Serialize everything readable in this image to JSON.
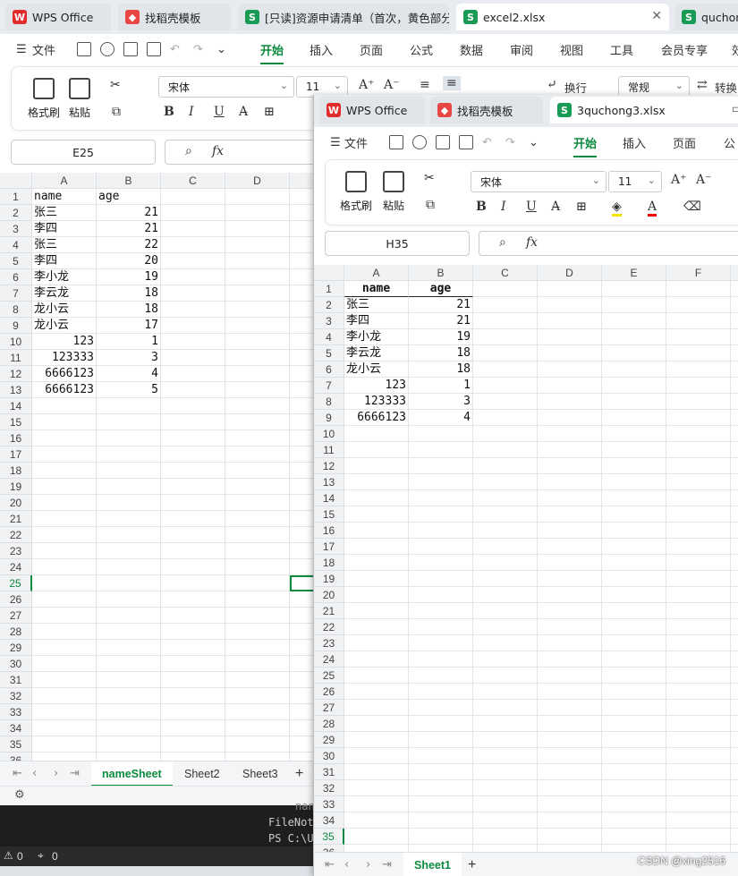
{
  "back_window": {
    "tabs": [
      {
        "label": "WPS Office"
      },
      {
        "label": "找稻壳模板"
      },
      {
        "label": "[只读]资源申请清单（首次，黄色部分"
      },
      {
        "label": "excel2.xlsx"
      },
      {
        "label": "quchon"
      }
    ],
    "menu": {
      "file": "文件",
      "items": [
        "开始",
        "插入",
        "页面",
        "公式",
        "数据",
        "审阅",
        "视图",
        "工具",
        "会员专享",
        "效"
      ]
    },
    "ribbon": {
      "format_painter": "格式刷",
      "paste": "粘贴",
      "font": "宋体",
      "font_size": "11",
      "wrap": "换行",
      "number_format": "常规",
      "convert": "转换"
    },
    "name_box": "E25",
    "fx": "fx",
    "columns": [
      "A",
      "B",
      "C",
      "D"
    ],
    "rows": [
      {
        "n": "1",
        "a": "name",
        "b": "age"
      },
      {
        "n": "2",
        "a": "张三",
        "b": "21"
      },
      {
        "n": "3",
        "a": "李四",
        "b": "21"
      },
      {
        "n": "4",
        "a": "张三",
        "b": "22"
      },
      {
        "n": "5",
        "a": "李四",
        "b": "20"
      },
      {
        "n": "6",
        "a": "李小龙",
        "b": "19"
      },
      {
        "n": "7",
        "a": "李云龙",
        "b": "18"
      },
      {
        "n": "8",
        "a": "龙小云",
        "b": "18"
      },
      {
        "n": "9",
        "a": "龙小云",
        "b": "17"
      },
      {
        "n": "10",
        "a": "123",
        "b": "1"
      },
      {
        "n": "11",
        "a": "123333",
        "b": "3"
      },
      {
        "n": "12",
        "a": "6666123",
        "b": "4"
      },
      {
        "n": "13",
        "a": "6666123",
        "b": "5"
      }
    ],
    "empty_rows": [
      "14",
      "15",
      "16",
      "17",
      "18",
      "19",
      "20",
      "21",
      "22",
      "23",
      "24",
      "25",
      "26",
      "27",
      "28",
      "29",
      "30",
      "31",
      "32",
      "33",
      "34",
      "35",
      "36"
    ],
    "sheets": [
      "nameSheet",
      "Sheet2",
      "Sheet3"
    ],
    "add_sheet": "+"
  },
  "front_window": {
    "tabs": [
      {
        "label": "WPS Office"
      },
      {
        "label": "找稻壳模板"
      },
      {
        "label": "3quchong3.xlsx"
      }
    ],
    "menu": {
      "file": "文件",
      "items": [
        "开始",
        "插入",
        "页面",
        "公"
      ]
    },
    "ribbon": {
      "format_painter": "格式刷",
      "paste": "粘贴",
      "font": "宋体",
      "font_size": "11"
    },
    "name_box": "H35",
    "fx": "fx",
    "columns": [
      "A",
      "B",
      "C",
      "D",
      "E",
      "F"
    ],
    "rows": [
      {
        "n": "1",
        "a": "name",
        "b": "age"
      },
      {
        "n": "2",
        "a": "张三",
        "b": "21"
      },
      {
        "n": "3",
        "a": "李四",
        "b": "21"
      },
      {
        "n": "4",
        "a": "李小龙",
        "b": "19"
      },
      {
        "n": "5",
        "a": "李云龙",
        "b": "18"
      },
      {
        "n": "6",
        "a": "龙小云",
        "b": "18"
      },
      {
        "n": "7",
        "a": "123",
        "b": "1"
      },
      {
        "n": "8",
        "a": "123333",
        "b": "3"
      },
      {
        "n": "9",
        "a": "6666123",
        "b": "4"
      }
    ],
    "empty_rows": [
      "10",
      "11",
      "12",
      "13",
      "14",
      "15",
      "16",
      "17",
      "18",
      "19",
      "20",
      "21",
      "22",
      "23",
      "24",
      "25",
      "26",
      "27",
      "28",
      "29",
      "30",
      "31",
      "32",
      "33",
      "34",
      "35",
      "36"
    ],
    "sheets": [
      "Sheet1"
    ],
    "add_sheet": "+"
  },
  "terminal": {
    "line1": "FileNot",
    "line2": "PS C:\\U",
    "partial": "nan"
  },
  "statusbar": {
    "warnings": "0",
    "infos": "0"
  },
  "watermark": "CSDN @xing2516"
}
